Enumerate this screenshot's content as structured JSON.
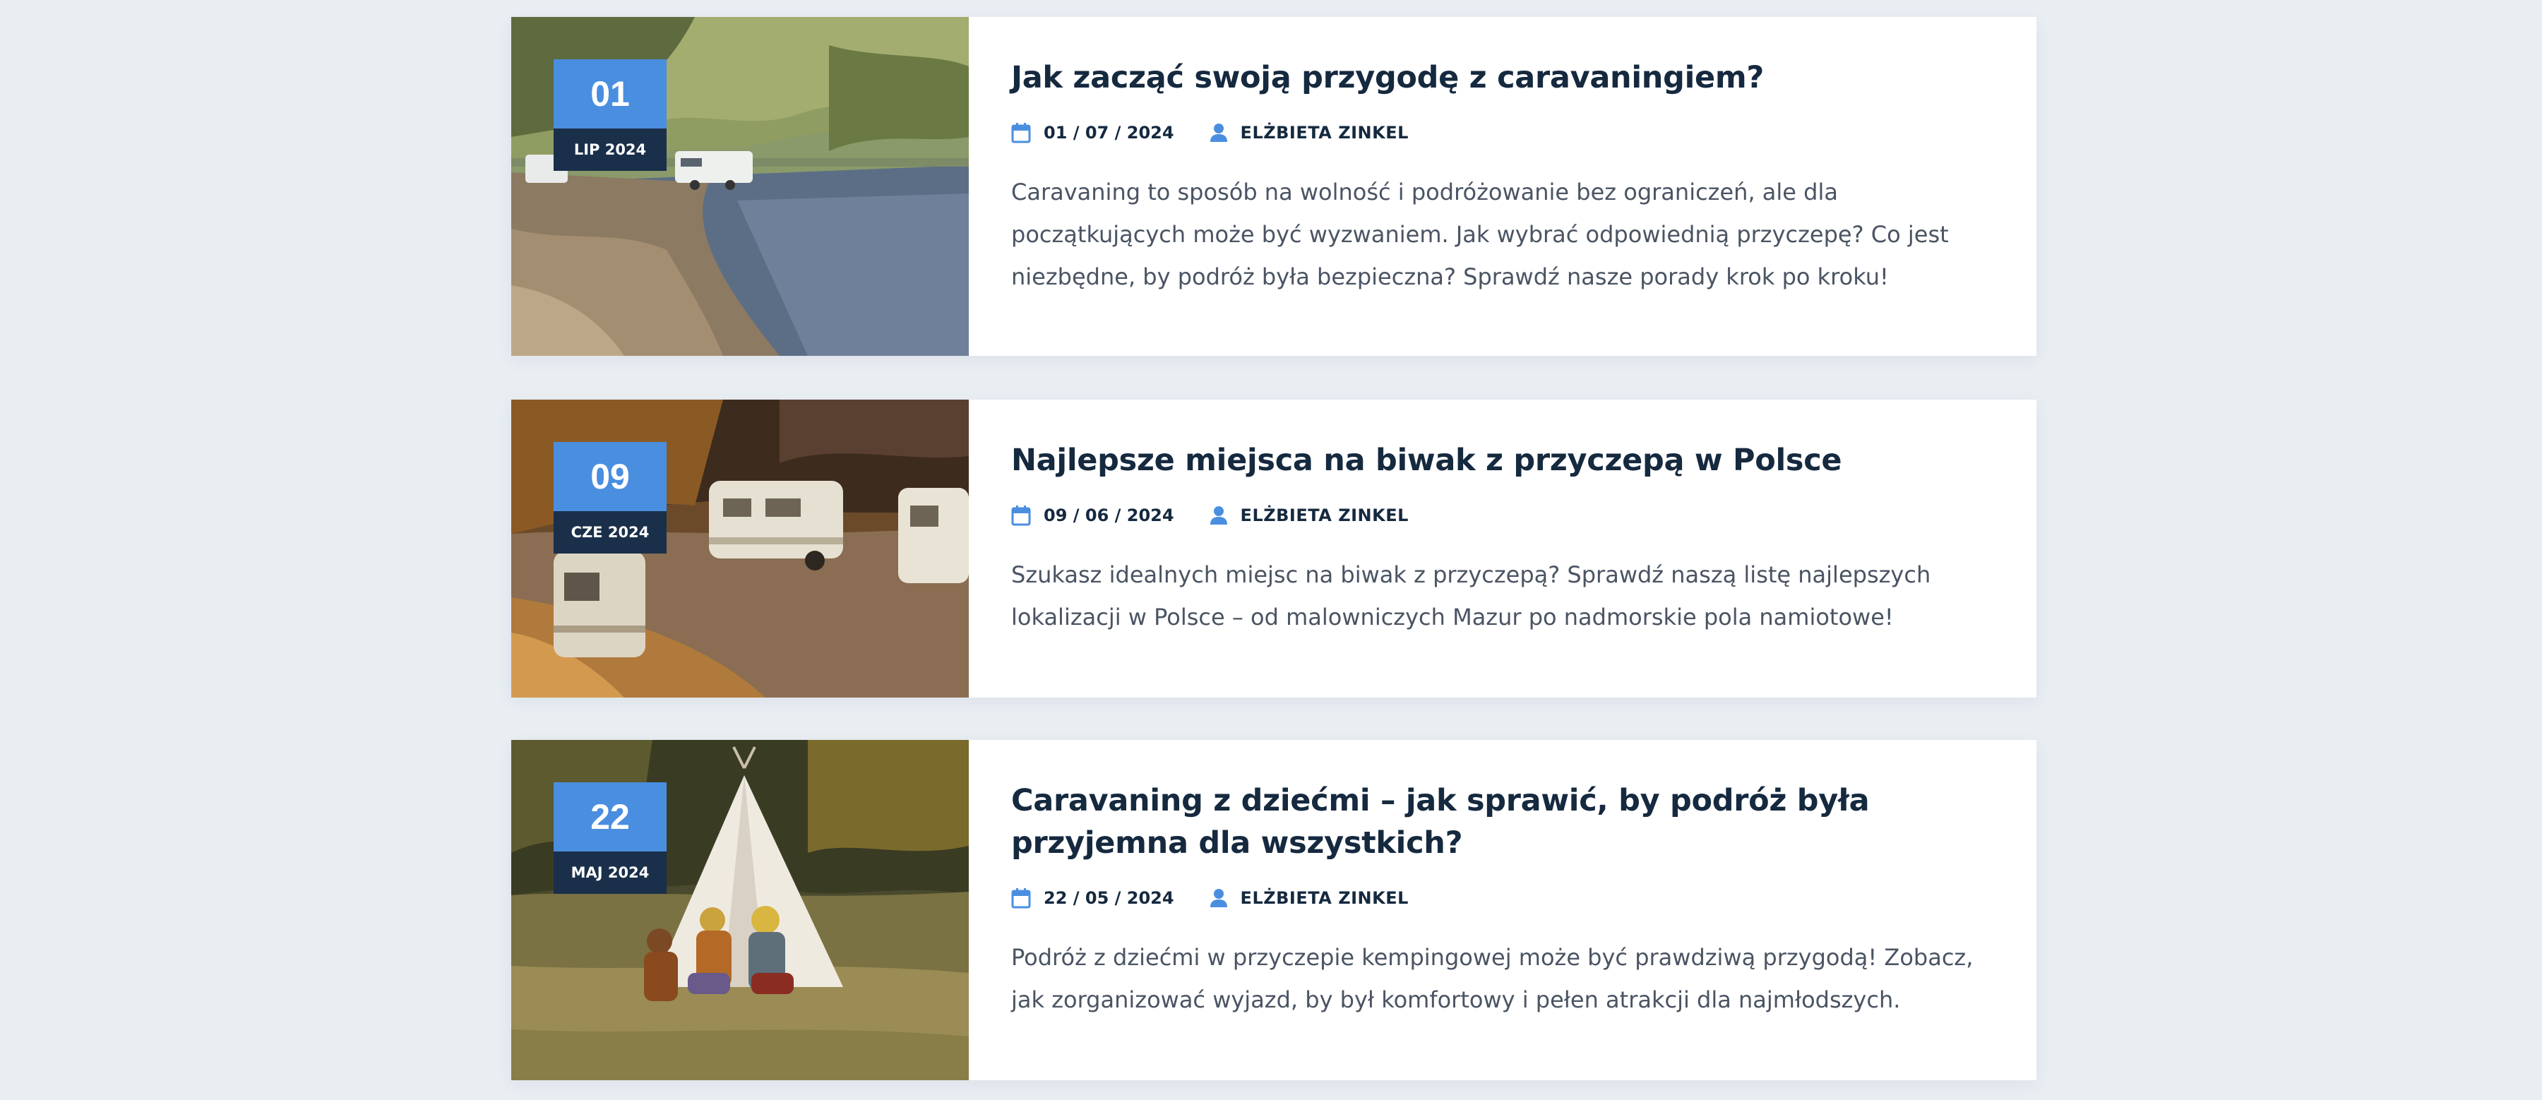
{
  "posts": [
    {
      "day": "01",
      "month": "LIP 2024",
      "title": "Jak zacząć swoją przygodę z caravaningiem?",
      "date": "01 / 07 / 2024",
      "author": "ELŻBIETA ZINKEL",
      "excerpt": "Caravaning to sposób na wolność i podróżowanie bez ograniczeń, ale dla początkujących może być wyzwaniem. Jak wybrać odpowiednią przyczepę? Co jest niezbędne, by podróż była bezpieczna? Sprawdź nasze porady krok po kroku!",
      "image": "lake-shore-caravans-photo"
    },
    {
      "day": "09",
      "month": "CZE 2024",
      "title": "Najlepsze miejsca na biwak z przyczepą w Polsce",
      "date": "09 / 06 / 2024",
      "author": "ELŻBIETA ZINKEL",
      "excerpt": "Szukasz idealnych miejsc na biwak z przyczepą? Sprawdź naszą listę najlepszych lokalizacji w Polsce – od malowniczych Mazur po nadmorskie pola namiotowe!",
      "image": "autumn-caravans-photo"
    },
    {
      "day": "22",
      "month": "MAJ 2024",
      "title": "Caravaning z dziećmi – jak sprawić, by podróż była przyjemna dla wszystkich?",
      "date": "22 / 05 / 2024",
      "author": "ELŻBIETA ZINKEL",
      "excerpt": "Podróż z dziećmi w przyczepie kempingowej może być prawdziwą przygodą! Zobacz, jak zorganizować wyjazd, by był komfortowy i pełen atrakcji dla najmłodszych.",
      "image": "children-teepee-photo"
    }
  ],
  "colors": {
    "accent": "#4a8ee0",
    "badge_dark": "#1a2f4a",
    "title": "#15293f",
    "text": "#4a5463",
    "background": "#e9eef3"
  },
  "icons": {
    "date": "calendar-icon",
    "author": "user-icon"
  }
}
